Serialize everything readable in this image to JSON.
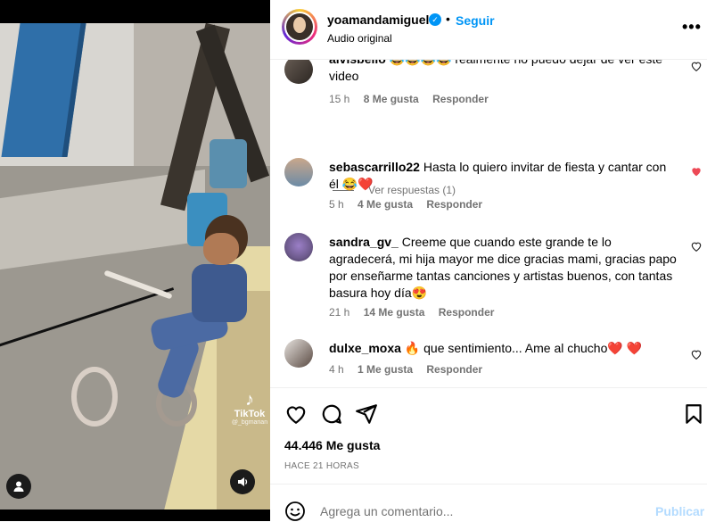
{
  "post": {
    "username": "yoamandamiguel",
    "verified_glyph": "✓",
    "separator": "•",
    "follow_label": "Seguir",
    "audio_label": "Audio original",
    "more_glyph": "•••"
  },
  "media": {
    "watermark_logo": "♪",
    "watermark_name": "TikTok",
    "watermark_user": "@_bgmarian",
    "user_icon": "user-icon",
    "sound_icon": "sound-icon"
  },
  "comments": [
    {
      "username": "aivisbello",
      "text": "😂😂😂😂 realmente no puedo dejar de ver este video",
      "time": "15 h",
      "likes": "8 Me gusta",
      "reply_label": "Responder",
      "liked": false
    },
    {
      "username": "sebascarrillo22",
      "text": "Hasta lo quiero invitar de fiesta y cantar con él 😂❤️",
      "time": "5 h",
      "likes": "4 Me gusta",
      "reply_label": "Responder",
      "liked": true
    },
    {
      "username": "sandra_gv_",
      "text": "Creeme que cuando este grande te lo agradecerá, mi hija mayor me dice gracias mami, gracias papo por enseñarme tantas canciones y artistas buenos, con tantas basura hoy día😍",
      "time": "21 h",
      "likes": "14 Me gusta",
      "reply_label": "Responder",
      "liked": false
    },
    {
      "username": "dulxe_moxa",
      "text": "🔥 que sentimiento... Ame al chucho❤️ ❤️",
      "time": "4 h",
      "likes": "1 Me gusta",
      "reply_label": "Responder",
      "liked": false
    }
  ],
  "view_replies_label": "Ver respuestas (1)",
  "actions": {
    "likes_count": "44.446 Me gusta",
    "time_ago": "HACE 21 HORAS"
  },
  "composer": {
    "placeholder": "Agrega un comentario...",
    "publish_label": "Publicar"
  },
  "colors": {
    "accent": "#0095f6",
    "heart_red": "#ed4956",
    "meta_gray": "#737373"
  }
}
